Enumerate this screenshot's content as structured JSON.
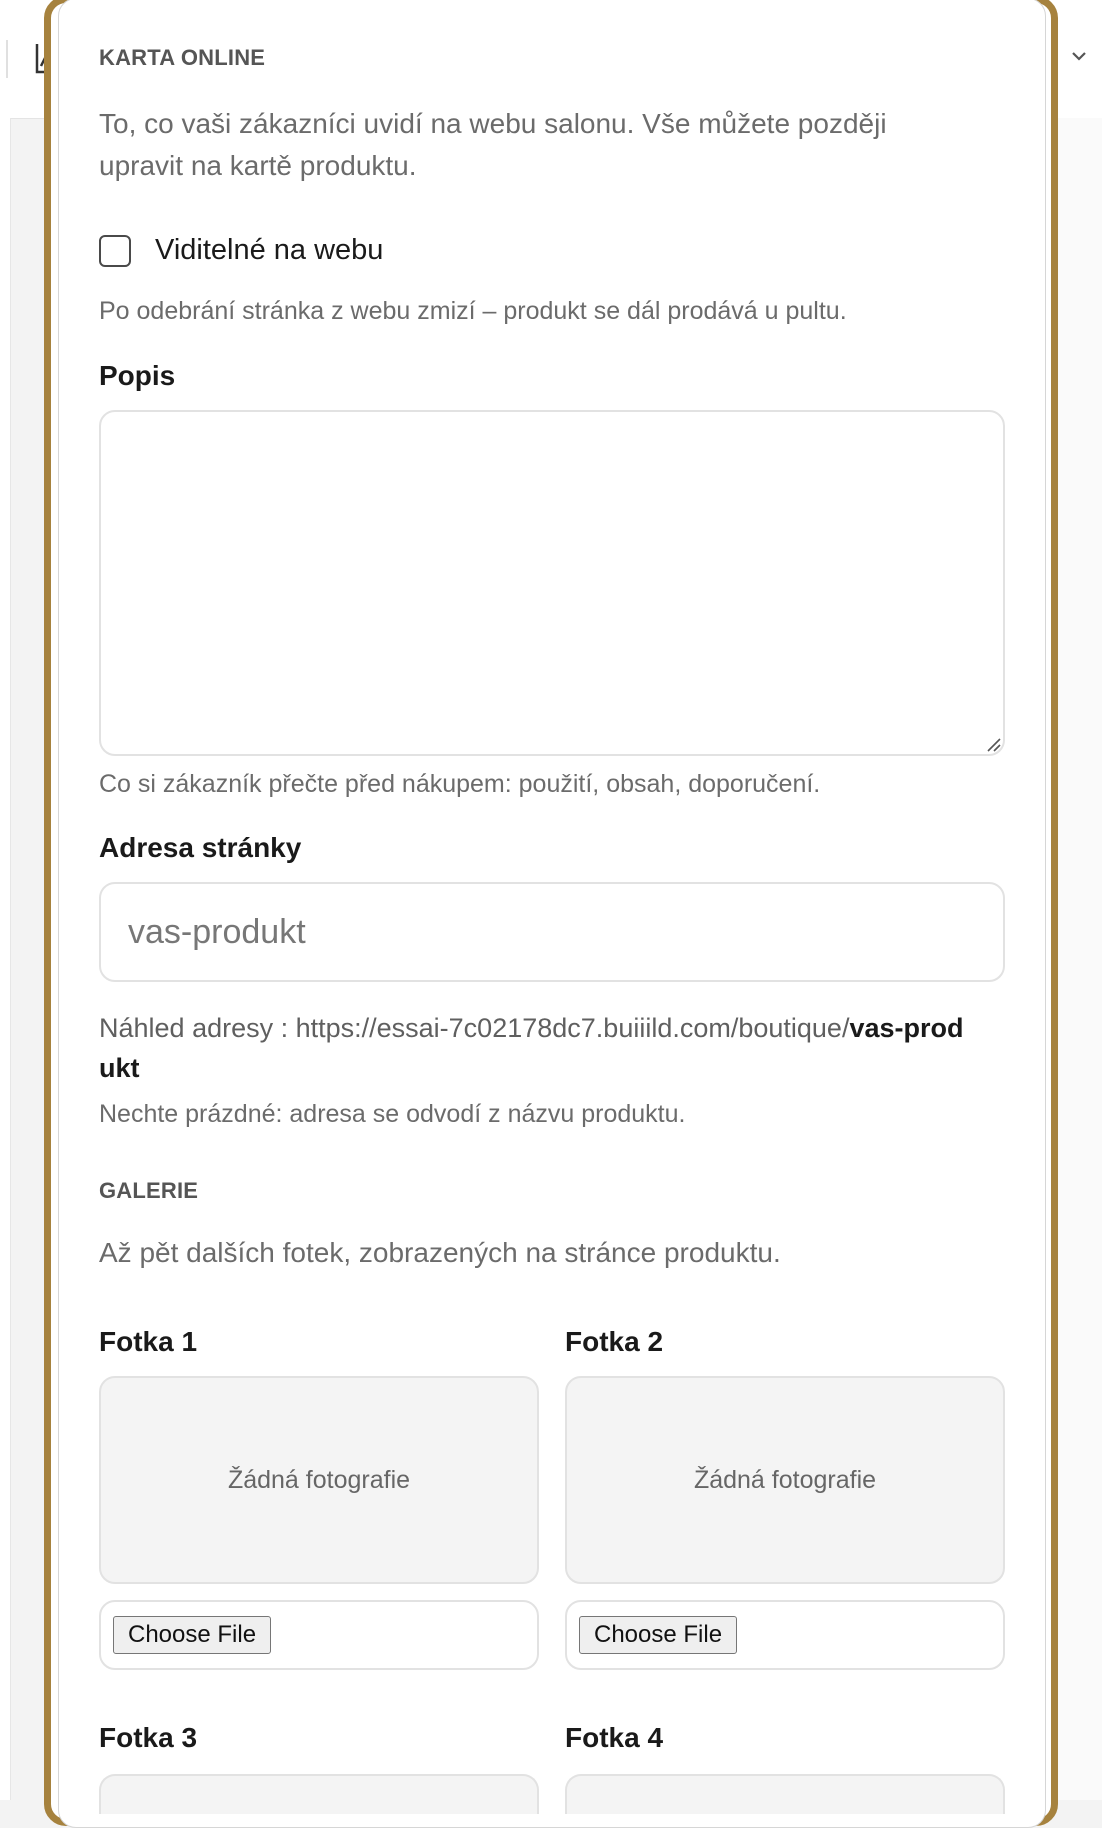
{
  "karta_online": {
    "section_title": "KARTA ONLINE",
    "description_line1": "To, co vaši zákazníci uvidí na webu salonu. Vše můžete později",
    "description_line2": "upravit na kartě produktu.",
    "visible_checkbox_label": "Viditelné na webu",
    "visible_checkbox_checked": false,
    "visible_hint": "Po odebrání stránka z webu zmizí – produkt se dál prodává u pultu."
  },
  "popis": {
    "label": "Popis",
    "value": "",
    "hint": "Co si zákazník přečte před nákupem: použití, obsah, doporučení."
  },
  "adresa": {
    "label": "Adresa stránky",
    "placeholder": "vas-produkt",
    "value": "",
    "preview_prefix": "Náhled adresy : https://essai-7c02178dc7.buiiild.com/boutique/",
    "preview_slug_part1": "vas-prod",
    "preview_slug_part2": "ukt",
    "hint": "Nechte prázdné: adresa se odvodí z názvu produktu."
  },
  "galerie": {
    "section_title": "GALERIE",
    "description": "Až pět dalších fotek, zobrazených na stránce produktu.",
    "photos": [
      {
        "label": "Fotka 1",
        "empty_text": "Žádná fotografie",
        "button": "Choose File"
      },
      {
        "label": "Fotka 2",
        "empty_text": "Žádná fotografie",
        "button": "Choose File"
      },
      {
        "label": "Fotka 3"
      },
      {
        "label": "Fotka 4"
      }
    ]
  },
  "icons": {
    "chart": "chart-icon",
    "chevron": "chevron-down-icon"
  },
  "colors": {
    "card_border": "#a6823e",
    "muted_text": "#6b6b6b",
    "photo_placeholder_bg": "#f4f4f4"
  }
}
